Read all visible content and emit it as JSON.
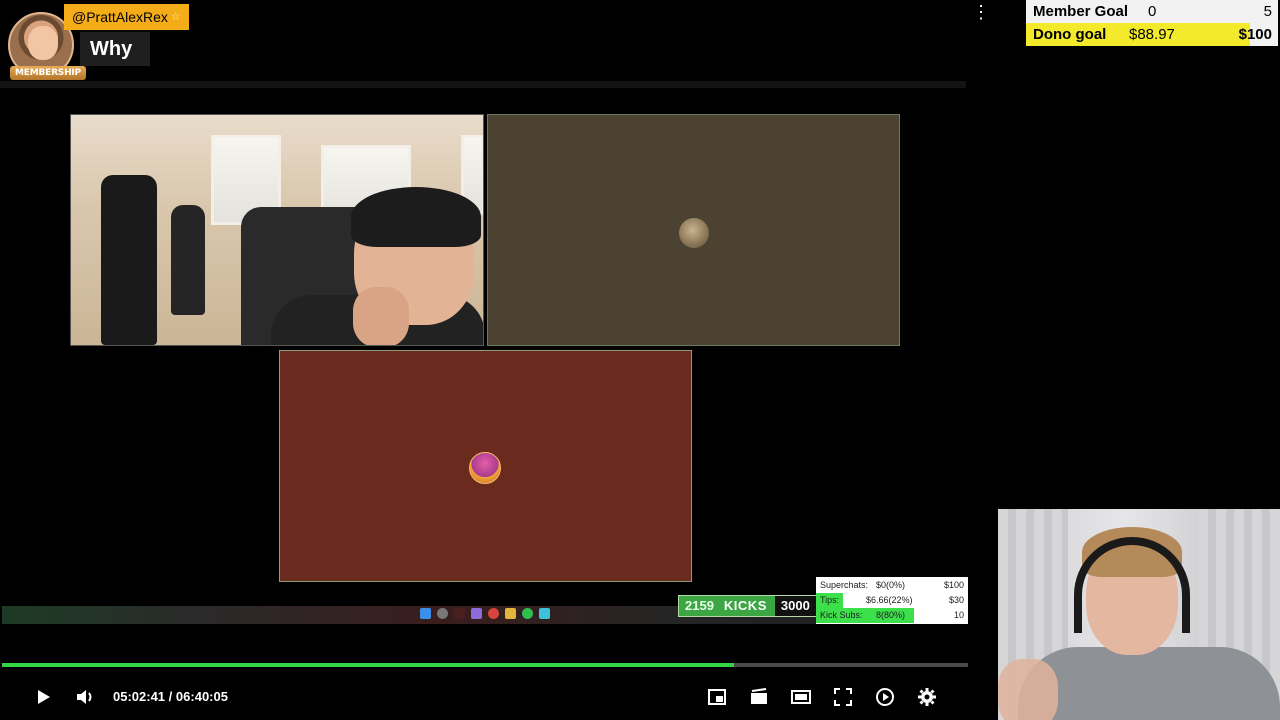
{
  "chat": {
    "username": "@PrattAlexRex",
    "badge_label": "MEMBERSHIP",
    "message": "Why"
  },
  "stream_overlay": {
    "kicks_current": "2159",
    "kicks_label": "KICKS",
    "kicks_goal": "3000",
    "mini_goals": [
      {
        "label": "Superchats:",
        "value": "$0(0%)",
        "goal": "$100",
        "fill_fraction": 0,
        "fill_color": "#ffffff"
      },
      {
        "label": "Tips:",
        "value": "$6.66(22%)",
        "goal": "$30",
        "fill_fraction": 0.22,
        "fill_color": "#3ce04a"
      },
      {
        "label": "Kick Subs:",
        "value": "8(80%)",
        "goal": "10",
        "fill_fraction": 0.8,
        "fill_color": "#3ce04a"
      }
    ]
  },
  "goals": {
    "member": {
      "label": "Member Goal",
      "current": "0",
      "goal": "5",
      "fill_fraction": 0,
      "bg": "#f2f2f2"
    },
    "dono": {
      "label": "Dono goal",
      "current": "$88.97",
      "goal": "$100",
      "fill_fraction": 0.8897,
      "fill_color": "#f2ea2a",
      "bg": "#f2f2f2"
    }
  },
  "player": {
    "current_time": "05:02:41",
    "separator": "/",
    "duration": "06:40:05",
    "progress_fraction": 0.758,
    "accent_color": "#33d545"
  },
  "icons": {
    "play": "play-icon",
    "volume": "volume-icon",
    "miniplayer": "miniplayer-icon",
    "chapters": "chapters-icon",
    "theater": "theater-mode-icon",
    "fullscreen": "fullscreen-icon",
    "autoplay": "autoplay-icon",
    "settings": "settings-icon",
    "menu": "more-vert-icon"
  }
}
